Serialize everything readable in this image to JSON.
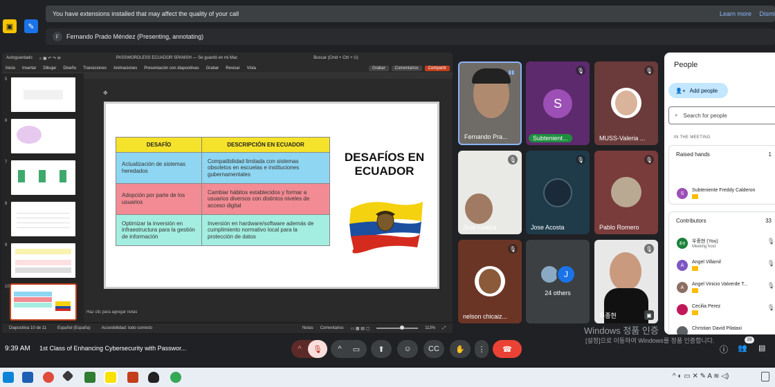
{
  "banner": {
    "extensions_text": "You have extensions installed that may affect the quality of your call",
    "learn_more": "Learn more",
    "dismiss": "Dismi"
  },
  "presenter": {
    "initial": "F",
    "text": "Fernando Prado Méndez (Presenting, annotating)"
  },
  "ppt": {
    "autosave": "Autoguardado",
    "file_title": "PASSWORDLESS ECUADOR SPANISH — Se guardó en mi Mac",
    "search": "Buscar (Cmd + Ctrl + U)",
    "menu": [
      "Inicio",
      "Insertar",
      "Dibujar",
      "Diseño",
      "Transiciones",
      "Animaciones",
      "Presentación con diapositivas",
      "Grabar",
      "Revisar",
      "Vista"
    ],
    "record_btn": "Grabar",
    "comments_btn": "Comentarios",
    "share_btn": "Compartir",
    "thumb_numbers": [
      "5",
      "6",
      "7",
      "8",
      "9",
      "10"
    ],
    "notes_placeholder": "Haz clic para agregar notas",
    "status": {
      "slide": "Diapositiva 10 de 11",
      "language": "Español (España)",
      "accessibility": "Accesibilidad: todo correcto",
      "notes": "Notas",
      "comments": "Comentarios",
      "zoom": "113%"
    }
  },
  "slide": {
    "headers": [
      "DESAFÍO",
      "DESCRIPCIÓN EN ECUADOR"
    ],
    "rows": [
      {
        "challenge": "Actualización de sistemas heredados",
        "description": "Compatibilidad limitada con sistemas obsoletos en escuelas e instituciones gubernamentales"
      },
      {
        "challenge": "Adopción por parte de los usuarios",
        "description": "Cambiar hábitos establecidos y formar a usuarios diversos con distintos niveles de acceso digital"
      },
      {
        "challenge": "Optimizar la inversión en infraestructura para la gestión de información",
        "description": "Inversión en hardware/software además de cumplimiento normativo local para la protección de datos"
      }
    ],
    "title": "DESAFÍOS EN ECUADOR"
  },
  "tiles": [
    {
      "name": "Fernando Pra...",
      "kind": "video"
    },
    {
      "name": "Subtenient...",
      "kind": "avatar",
      "initial": "S"
    },
    {
      "name": "MUSS-Valeria ...",
      "kind": "photo"
    },
    {
      "name": "Jose Loaiza",
      "kind": "video"
    },
    {
      "name": "Jose Acosta",
      "kind": "photo"
    },
    {
      "name": "Pablo Romero",
      "kind": "photo"
    },
    {
      "name": "nelson chicaiz...",
      "kind": "photo"
    },
    {
      "name": "24 others",
      "kind": "others",
      "initial": "J"
    },
    {
      "name": "우종현",
      "kind": "video"
    }
  ],
  "people": {
    "title": "People",
    "add_people": "Add people",
    "search_placeholder": "Search for people",
    "in_meeting": "IN THE MEETING",
    "raised_hands": "Raised hands",
    "raised_count": "1",
    "raised_person": "Subteniente Freddy Calderon",
    "contributors": "Contributors",
    "contributors_count": "33",
    "list": [
      {
        "initial": "종현",
        "name": "우종현 (You)",
        "sub": "Meeting host",
        "color": "#188038"
      },
      {
        "initial": "A",
        "name": "Angel Villamil",
        "sub": "",
        "color": "#7e57c2"
      },
      {
        "initial": "A",
        "name": "Angel Vinicio Valverde T...",
        "sub": "",
        "color": "#8d6e63"
      },
      {
        "initial": "",
        "name": "Cecilia Perez",
        "sub": "",
        "color": "#c2185b"
      },
      {
        "initial": "",
        "name": "Christian David Pilataxi",
        "sub": "",
        "color": "#5f6368"
      }
    ]
  },
  "bottom": {
    "time": "9:39 AM",
    "title": "1st Class of Enhancing Cybersecurity with Passwor...",
    "participant_count": "33"
  },
  "windows": {
    "line1": "Windows 정품 인증",
    "line2": "[설정]으로 이동하여 Windows를 정품 인증합니다."
  },
  "colors": {
    "end_call": "#ea4335",
    "mic_off": "#f9dedc",
    "accent": "#8ab4f8"
  }
}
